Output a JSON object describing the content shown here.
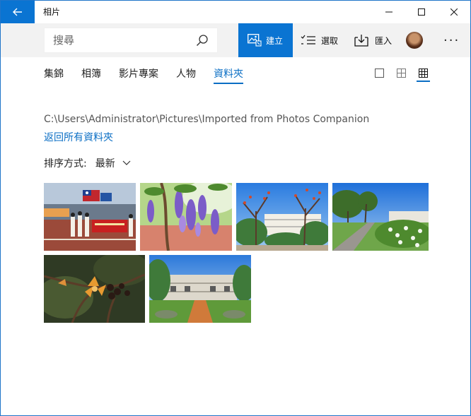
{
  "app": {
    "title": "相片"
  },
  "toolbar": {
    "search_placeholder": "搜尋",
    "create_label": "建立",
    "select_label": "選取",
    "import_label": "匯入",
    "accent": "#0a74d2"
  },
  "tabs": [
    {
      "label": "集錦"
    },
    {
      "label": "相簿"
    },
    {
      "label": "影片專案"
    },
    {
      "label": "人物"
    },
    {
      "label": "資料夾",
      "active": true
    }
  ],
  "folder": {
    "path": "C:\\Users\\Administrator\\Pictures\\Imported from Photos Companion",
    "back_link": "返回所有資料夾"
  },
  "sort": {
    "label": "排序方式:",
    "value": "最新"
  },
  "icons": [
    "back-arrow-icon",
    "minimize-icon",
    "maximize-icon",
    "close-icon",
    "search-icon",
    "create-icon",
    "select-icon",
    "import-icon",
    "more-icon",
    "view-large-icon",
    "view-medium-icon",
    "view-small-icon",
    "chevron-down-icon"
  ]
}
